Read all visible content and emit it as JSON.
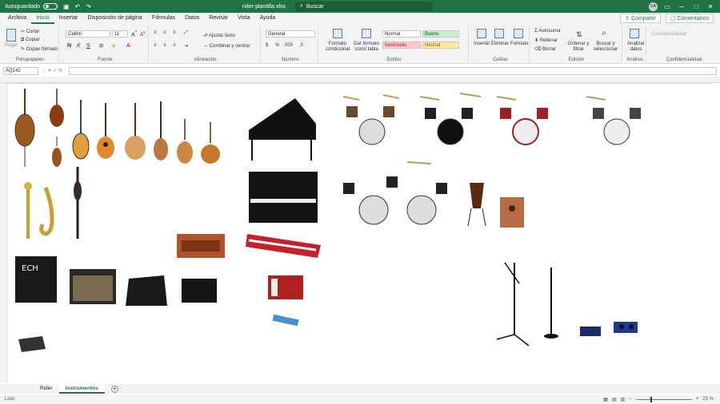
{
  "titlebar": {
    "autosave": "Autoguardado",
    "filename": "rider-plantilla.xlsx",
    "search_placeholder": "Buscar",
    "user_initials": "GA"
  },
  "menu": {
    "items": [
      "Archivo",
      "Inicio",
      "Insertar",
      "Disposición de página",
      "Fórmulas",
      "Datos",
      "Revisar",
      "Vista",
      "Ayuda"
    ],
    "share": "Compartir",
    "comments": "Comentarios"
  },
  "ribbon": {
    "portapapeles": {
      "label": "Portapapeles",
      "paste": "Pegar",
      "cut": "Cortar",
      "copy": "Copiar",
      "format": "Copiar formato"
    },
    "fuente": {
      "label": "Fuente",
      "font": "Calibri",
      "size": "11"
    },
    "alineacion": {
      "label": "Alineación",
      "wrap": "Ajustar texto",
      "merge": "Combinar y centrar"
    },
    "numero": {
      "label": "Número",
      "format": "General"
    },
    "estilos": {
      "label": "Estilos",
      "cond": "Formato condicional",
      "table": "Dar formato como tabla",
      "normal": "Normal",
      "bueno": "Bueno",
      "incorrecto": "Incorrecto",
      "neutral": "Neutral"
    },
    "celdas": {
      "label": "Celdas",
      "insert": "Insertar",
      "delete": "Eliminar",
      "format": "Formato"
    },
    "edicion": {
      "label": "Edición",
      "autosum": "Autosuma",
      "fill": "Rellenar",
      "clear": "Borrar",
      "sort": "Ordenar y filtrar",
      "find": "Buscar y seleccionar"
    },
    "analisis": {
      "label": "Análisis",
      "analyze": "Analizar datos"
    },
    "confidencialidad": {
      "label": "Confidencialidad",
      "btn": "Confidencialidad"
    }
  },
  "formulabar": {
    "cell": "AQ142",
    "fx": "fx"
  },
  "tabs": [
    "Rider",
    "Instrumentos"
  ],
  "status": {
    "ready": "Listo",
    "zoom": "25 %"
  },
  "colors": {
    "excel_green": "#217346"
  }
}
